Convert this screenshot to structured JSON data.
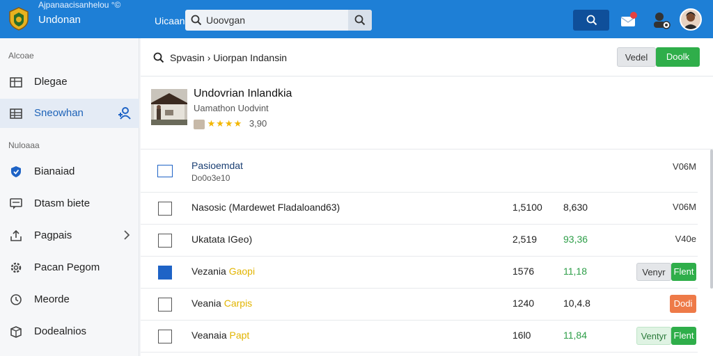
{
  "header": {
    "app_subtitle": "Ajpanaacisanhelou °©",
    "app_title": "Undonan",
    "label": "Uicaan",
    "search": {
      "value": "Uoovgan"
    }
  },
  "sidebar": {
    "section1": "Alcoae",
    "section2": "Nuloaaa",
    "items": [
      {
        "label": "Dlegae",
        "icon": "grid-icon"
      },
      {
        "label": "Sneowhan",
        "icon": "table-icon",
        "active": true
      },
      {
        "label": "Bianaiad",
        "icon": "shield-icon"
      },
      {
        "label": "Dtasm biete",
        "icon": "chat-icon"
      },
      {
        "label": "Pagpais",
        "icon": "share-icon"
      },
      {
        "label": "Pacan Pegom",
        "icon": "gear-icon"
      },
      {
        "label": "Meorde",
        "icon": "clock-icon"
      },
      {
        "label": "Dodealnios",
        "icon": "box-icon"
      }
    ]
  },
  "breadcrumb": {
    "text": "Spvasin › Uiorpan Indansin"
  },
  "toolbar": {
    "secondary_label": "Vedel",
    "primary_label": "Doolk"
  },
  "product": {
    "title": "Undovrian Inlandkia",
    "subtitle": "Uamathon Uodvint",
    "rating": 3.5,
    "rating_text": "3,90"
  },
  "list_header": {
    "title": "Pasioemdat",
    "subtitle": "Do0o3e10",
    "tail": "V06M"
  },
  "rows": [
    {
      "name": "Nasosic (Mardewet Fladaloand63)",
      "hl": "",
      "n1": "1,5100",
      "n2": "8,630",
      "n2_green": false,
      "checked": false,
      "tail": "V06M",
      "actions": []
    },
    {
      "name": "Ukatata IGeo)",
      "hl": "",
      "n1": "2,519",
      "n2": "93,36",
      "n2_green": true,
      "checked": false,
      "tail": "V40e",
      "actions": []
    },
    {
      "name": "Vezania ",
      "hl": "Gaopi",
      "n1": "1576",
      "n2": "11,18",
      "n2_green": true,
      "checked": true,
      "tail": "",
      "actions": [
        {
          "label": "Venyr",
          "style": "grey"
        },
        {
          "label": "Flent",
          "style": "green"
        }
      ]
    },
    {
      "name": "Veania ",
      "hl": "Carpis",
      "n1": "1240",
      "n2": "10,4.8",
      "n2_green": false,
      "checked": false,
      "tail": "",
      "actions": [
        {
          "label": "Dodi",
          "style": "orange"
        }
      ]
    },
    {
      "name": "Veanaia ",
      "hl": "Papt",
      "n1": "16l0",
      "n2": "11,84",
      "n2_green": true,
      "checked": false,
      "tail": "",
      "actions": [
        {
          "label": "Ventyr",
          "style": "lightgreen"
        },
        {
          "label": "Flent",
          "style": "green"
        }
      ]
    }
  ],
  "colors": {
    "topbar": "#1e7fd6",
    "accent": "#1e63c6",
    "success": "#2fae4a",
    "warning": "#ee7a48",
    "star": "#f2b600"
  }
}
